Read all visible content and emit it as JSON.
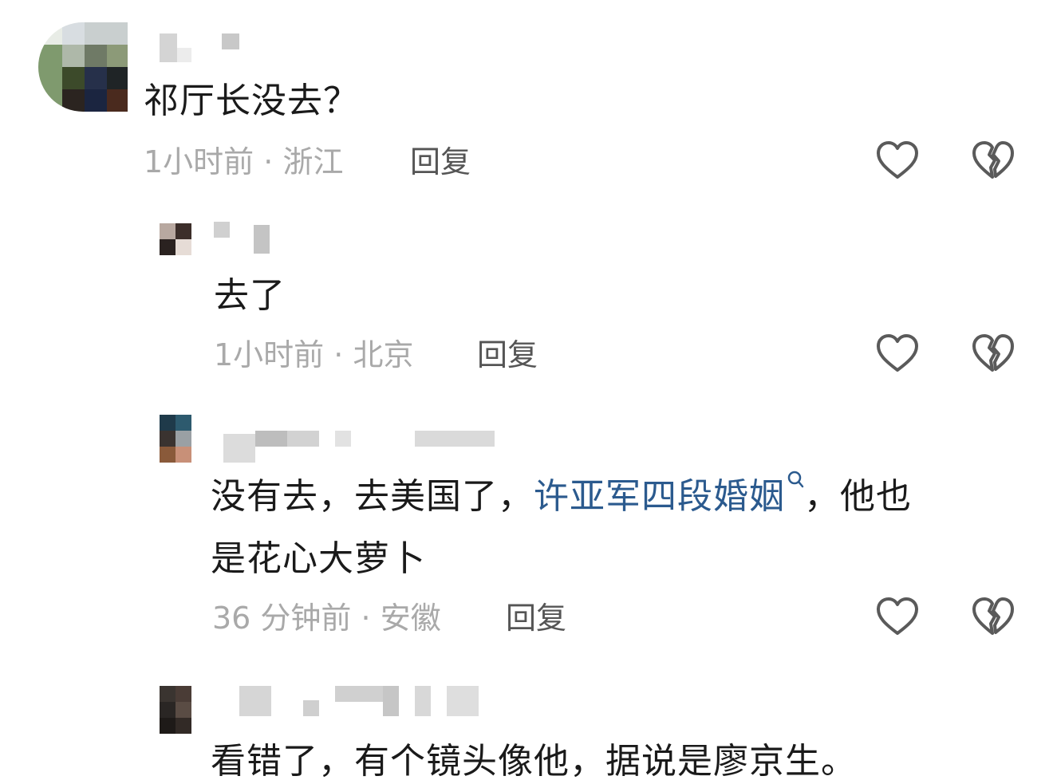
{
  "comments": [
    {
      "text": "祁厅长没去？",
      "time": "1小时前",
      "location": "浙江",
      "reply": "回复"
    },
    {
      "text": "去了",
      "time": "1小时前",
      "location": "北京",
      "reply": "回复"
    },
    {
      "text_before": "没有去，去美国了，",
      "link": "许亚军四段婚姻",
      "text_after": "，他也",
      "text_line2": "是花心大萝卜",
      "time": "36 分钟前",
      "location": "安徽",
      "reply": "回复"
    },
    {
      "text": "看错了，有个镜头像他，据说是廖京生。"
    }
  ],
  "meta_separator": " · ",
  "icons": {
    "like": "heart-outline-icon",
    "dislike": "broken-heart-icon",
    "search": "search-icon"
  },
  "colors": {
    "text": "#1a1a1a",
    "meta": "#a9a9a9",
    "link": "#2b5a8e",
    "icon": "#5a5a5a"
  }
}
